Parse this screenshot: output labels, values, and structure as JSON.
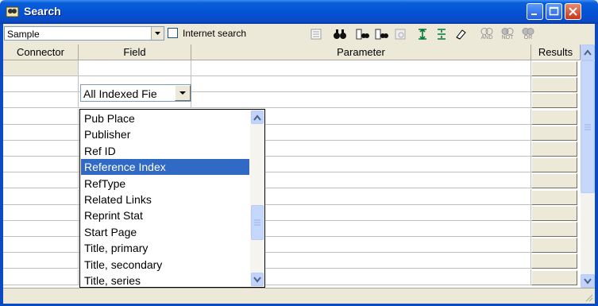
{
  "window": {
    "title": "Search"
  },
  "toolbar": {
    "database_value": "Sample",
    "internet_search_label": "Internet search",
    "internet_search_checked": false,
    "boolean_buttons": [
      "AND",
      "NOT",
      "OR"
    ]
  },
  "grid": {
    "headers": [
      "Connector",
      "Field",
      "Parameter",
      "Results"
    ],
    "first_row_field": "All Indexed Fie"
  },
  "dropdown": {
    "items": [
      "Pub Place",
      "Publisher",
      "Ref ID",
      "Reference Index",
      "RefType",
      "Related Links",
      "Reprint Stat",
      "Start Page",
      "Title, primary",
      "Title, secondary",
      "Title, series"
    ],
    "selected": "Reference Index"
  },
  "colors": {
    "titlebar": "#0453d6",
    "selection": "#316ac5",
    "chrome": "#ece9d8"
  }
}
